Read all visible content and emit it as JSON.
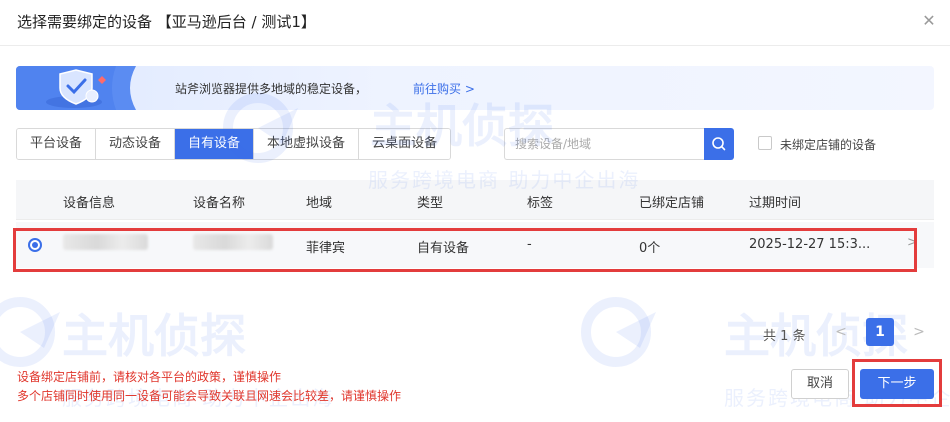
{
  "dialog": {
    "title": "选择需要绑定的设备 【亚马逊后台 / 测试1】",
    "close_icon": "close-icon"
  },
  "banner": {
    "text": "站斧浏览器提供多地域的稳定设备，",
    "link": "前往购买 >"
  },
  "tabs": [
    {
      "label": "平台设备",
      "active": false
    },
    {
      "label": "动态设备",
      "active": false
    },
    {
      "label": "自有设备",
      "active": true
    },
    {
      "label": "本地虚拟设备",
      "active": false
    },
    {
      "label": "云桌面设备",
      "active": false
    }
  ],
  "search": {
    "placeholder": "搜索设备/地域",
    "value": "",
    "icon": "search-icon"
  },
  "filter": {
    "unbound_label": "未绑定店铺的设备",
    "checked": false
  },
  "table": {
    "columns": [
      "设备信息",
      "设备名称",
      "地域",
      "类型",
      "标签",
      "已绑定店铺",
      "过期时间"
    ],
    "rows": [
      {
        "selected": true,
        "device_info": "",
        "device_name": "",
        "region": "菲律宾",
        "type": "自有设备",
        "tag": "-",
        "bound_shops": "0个",
        "expire_time": "2025-12-27 15:3...",
        "arrow": ">"
      }
    ]
  },
  "pagination": {
    "total": "共 1 条",
    "prev": "<",
    "current_page": "1",
    "next": ">"
  },
  "notes": [
    "设备绑定店铺前，请核对各平台的政策，谨慎操作",
    "多个店铺同时使用同一设备可能会导致关联且网速会比较差，请谨慎操作"
  ],
  "footer": {
    "cancel_label": "取消",
    "next_label": "下一步"
  },
  "watermark": {
    "brand": "主机侦探",
    "slogan": "服务跨境电商 助力中企出海"
  },
  "colors": {
    "primary": "#3b6fe8",
    "highlight_border": "#e33c3c",
    "warning_text": "#e0362c"
  }
}
